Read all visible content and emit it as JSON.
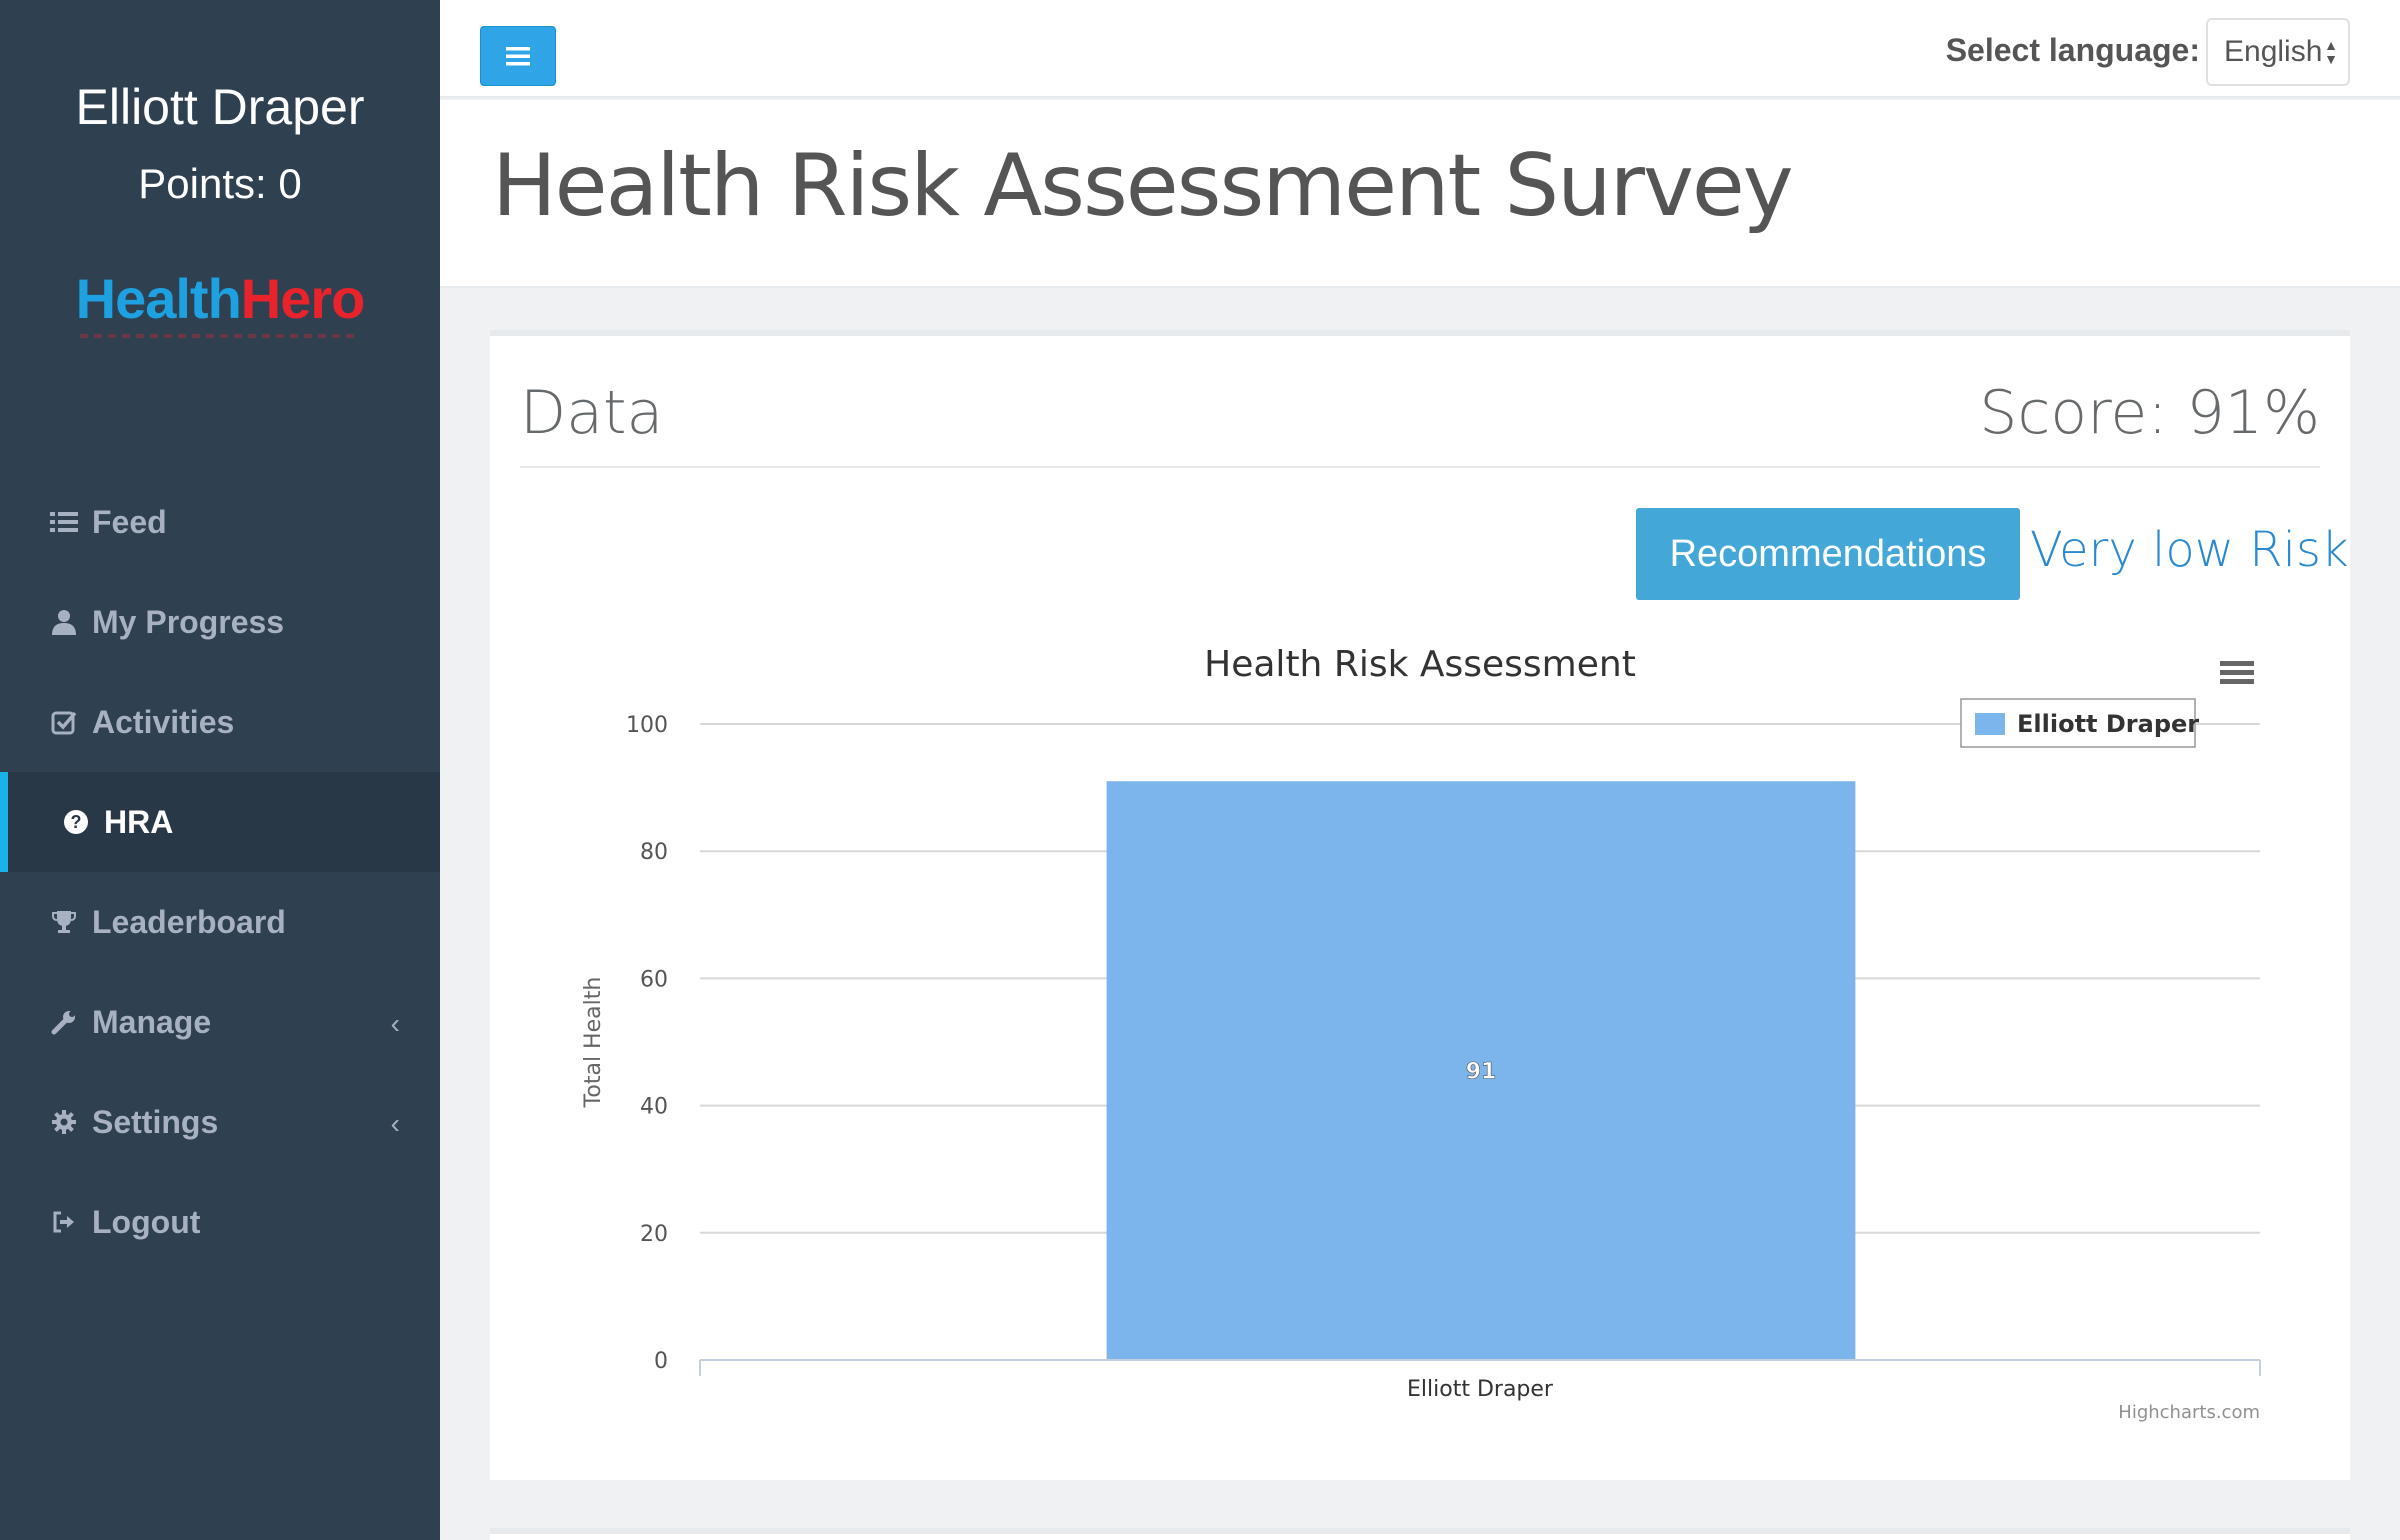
{
  "user": {
    "name": "Elliott Draper",
    "points": "Points: 0"
  },
  "logo": {
    "part1": "Health",
    "part2": "Hero"
  },
  "nav": {
    "items": [
      {
        "label": "Feed",
        "icon": "list-icon"
      },
      {
        "label": "My Progress",
        "icon": "user-icon"
      },
      {
        "label": "Activities",
        "icon": "check-square-icon"
      },
      {
        "label": "HRA",
        "icon": "question-circle-icon",
        "active": true
      },
      {
        "label": "Leaderboard",
        "icon": "trophy-icon"
      },
      {
        "label": "Manage",
        "icon": "wrench-icon",
        "has_submenu": true
      },
      {
        "label": "Settings",
        "icon": "gear-icon",
        "has_submenu": true
      },
      {
        "label": "Logout",
        "icon": "sign-out-icon"
      }
    ]
  },
  "topbar": {
    "language_label": "Select language:",
    "language_value": "English"
  },
  "page": {
    "title": "Health Risk Assessment Survey"
  },
  "panel": {
    "title": "Data",
    "score": "Score: 91%",
    "recommendations_label": "Recommendations",
    "risk_level": "Very low Risk"
  },
  "colors": {
    "sidebar": "#2f4050",
    "accent": "#2fa4e7",
    "bar": "#7cb5ec",
    "risk_text": "#2a8ad1"
  },
  "chart_data": {
    "type": "bar",
    "title": "Health Risk Assessment",
    "categories": [
      "Elliott Draper"
    ],
    "series": [
      {
        "name": "Elliott Draper",
        "values": [
          91
        ]
      }
    ],
    "ylabel": "Total Health",
    "xlabel": "",
    "ylim": [
      0,
      100
    ],
    "yticks": [
      0,
      20,
      40,
      60,
      80,
      100
    ],
    "data_labels": [
      "91"
    ],
    "legend": "top-right",
    "grid": true,
    "credit": "Highcharts.com"
  }
}
